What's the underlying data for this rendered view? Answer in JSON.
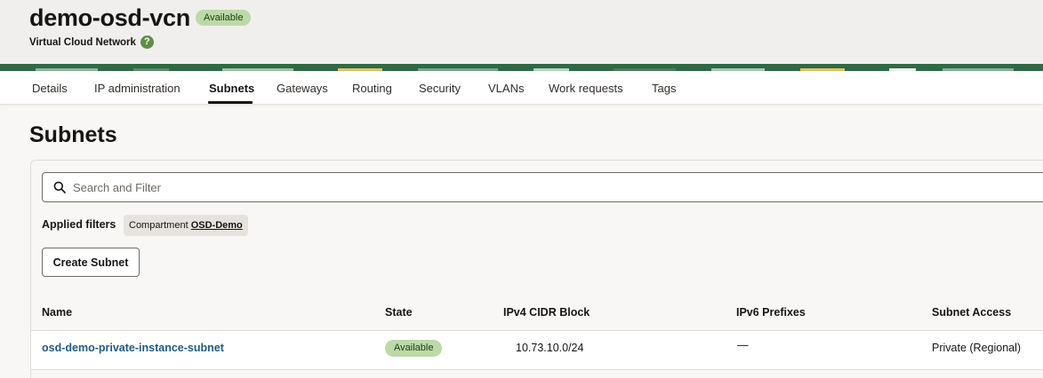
{
  "header": {
    "title": "demo-osd-vcn",
    "status_badge": "Available",
    "subtitle": "Virtual Cloud Network",
    "help_icon": "?"
  },
  "tabs": [
    {
      "label": "Details"
    },
    {
      "label": "IP administration"
    },
    {
      "label": "Subnets",
      "active": true
    },
    {
      "label": "Gateways"
    },
    {
      "label": "Routing"
    },
    {
      "label": "Security"
    },
    {
      "label": "VLANs"
    },
    {
      "label": "Work requests"
    },
    {
      "label": "Tags"
    }
  ],
  "main": {
    "page_title": "Subnets",
    "search": {
      "placeholder": "Search and Filter",
      "value": "",
      "icon": "search-icon"
    },
    "filters": {
      "label": "Applied filters",
      "chip": {
        "key": "Compartment",
        "value": "OSD-Demo"
      }
    },
    "create_button": "Create Subnet",
    "table": {
      "columns": [
        "Name",
        "State",
        "IPv4 CIDR Block",
        "IPv6 Prefixes",
        "Subnet Access"
      ],
      "rows": [
        {
          "name": "osd-demo-private-instance-subnet",
          "state": "Available",
          "ipv4": "10.73.10.0/24",
          "ipv6": "—",
          "access": "Private (Regional)"
        }
      ]
    }
  },
  "colors": {
    "accent_green_badge": "#bcd9a8",
    "link_blue": "#1e5b85",
    "banner_green": "#2f6a46"
  }
}
